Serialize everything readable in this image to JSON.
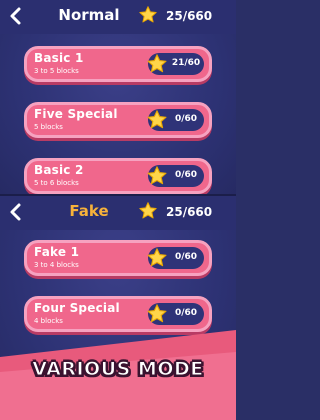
{
  "top_screen": {
    "title": "Normal",
    "score": "25/660",
    "levels": [
      {
        "name": "Basic 1",
        "desc": "3 to 5 blocks",
        "progress": "21/60"
      },
      {
        "name": "Five Special",
        "desc": "5 blocks",
        "progress": "0/60"
      },
      {
        "name": "Basic 2",
        "desc": "5 to 6 blocks",
        "progress": "0/60"
      }
    ]
  },
  "bottom_screen": {
    "title": "Fake",
    "score": "25/660",
    "levels": [
      {
        "name": "Fake 1",
        "desc": "3 to 4 blocks",
        "progress": "0/60"
      },
      {
        "name": "Four Special",
        "desc": "4 blocks",
        "progress": "0/60"
      }
    ]
  },
  "banner": "VARIOUS MODE",
  "icons": {
    "back": "chevron-left-icon",
    "star": "star-icon"
  },
  "colors": {
    "card": "#f0678c",
    "card_border": "#f6a2c0",
    "header_bg": "#2b2f70",
    "fake_title": "#f7b23a",
    "star": "#ffd54a"
  }
}
